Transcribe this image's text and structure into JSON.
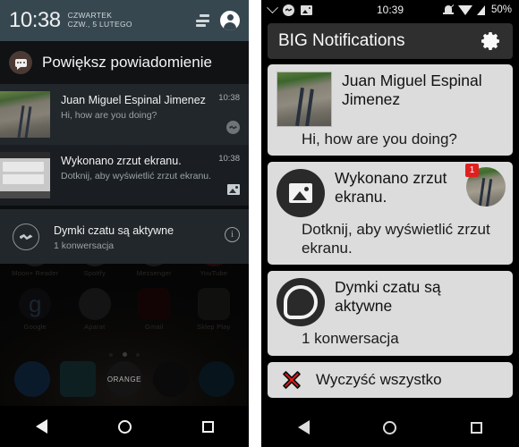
{
  "left_phone": {
    "status_bar": {
      "clock": "10:38",
      "date_line1": "CZWARTEK",
      "date_line2": "CZW., 5 LUTEGO",
      "sort_icon": "sort-icon",
      "avatar_icon": "user-avatar-icon"
    },
    "header": {
      "app_icon": "chat-bubble-icon",
      "title": "Powiększ powiadomienie"
    },
    "notifications": [
      {
        "thumbnail": "road-photo-thumbnail",
        "title": "Juan Miguel Espinal Jimenez",
        "text": "Hi, how are you doing?",
        "time": "10:38",
        "action_icon": "messenger-icon"
      },
      {
        "thumbnail": "screenshot-thumbnail",
        "title": "Wykonano zrzut ekranu.",
        "text": "Dotknij, aby wyświetlić zrzut ekranu.",
        "time": "10:38",
        "action_icon": "image-icon"
      },
      {
        "thumbnail": "messenger-circle-icon",
        "title": "Dymki czatu są aktywne",
        "text": "1 konwersacja",
        "time": "",
        "action_icon": "info-icon"
      }
    ],
    "home_screen": {
      "row1": [
        {
          "icon": "moon-reader-icon",
          "label": "Moon+ Reader"
        },
        {
          "icon": "spotify-icon",
          "label": "Spotify"
        },
        {
          "icon": "messenger-app-icon",
          "label": "Messenger"
        },
        {
          "icon": "youtube-icon",
          "label": "YouTube"
        }
      ],
      "row2": [
        {
          "icon": "google-icon",
          "label": "Google"
        },
        {
          "icon": "camera-icon",
          "label": "Aparat"
        },
        {
          "icon": "gmail-icon",
          "label": "Gmail"
        },
        {
          "icon": "play-store-icon",
          "label": "Sklep Play"
        }
      ],
      "dock": [
        {
          "icon": "phone-icon",
          "label": ""
        },
        {
          "icon": "contacts-icon",
          "label": ""
        },
        {
          "icon": "orange-icon",
          "label": "ORANGE"
        },
        {
          "icon": "messages-icon",
          "label": ""
        },
        {
          "icon": "browser-icon",
          "label": ""
        }
      ]
    },
    "nav_bar": {
      "back": "back-icon",
      "home": "home-icon",
      "recents": "recents-icon"
    }
  },
  "right_phone": {
    "status_bar": {
      "chevron_icon": "chevron-down-icon",
      "messenger_icon": "messenger-icon",
      "image_icon": "image-icon",
      "clock": "10:39",
      "mute_icon": "mute-icon",
      "wifi_icon": "wifi-icon",
      "signal_icon": "signal-icon",
      "battery": "50%"
    },
    "header": {
      "title": "BIG Notifications",
      "settings_icon": "gear-icon"
    },
    "cards": [
      {
        "leading": "road-photo-thumbnail",
        "title": "Juan Miguel Espinal Jimenez",
        "text": "Hi, how are you doing?",
        "badge": "",
        "corner_thumb": ""
      },
      {
        "leading": "image-icon",
        "title": "Wykonano zrzut ekranu.",
        "text": "Dotknij, aby wyświetlić zrzut ekranu.",
        "badge": "1",
        "corner_thumb": "road-photo-thumbnail"
      },
      {
        "leading": "messenger-icon",
        "title": "Dymki czatu są aktywne",
        "text": "1 konwersacja",
        "badge": "",
        "corner_thumb": ""
      }
    ],
    "clear_all": {
      "icon": "red-x-icon",
      "label": "Wyczyść wszystko"
    },
    "nav_bar": {
      "back": "back-icon",
      "home": "home-icon",
      "recents": "recents-icon"
    }
  },
  "colors": {
    "left_status_bar": "#37474f",
    "left_notification_bg": "#22272b",
    "right_card_bg": "#dcdcdc",
    "right_header_bg": "#2f2f2f",
    "badge_red": "#e02020",
    "clear_x_red": "#e01b1b"
  }
}
